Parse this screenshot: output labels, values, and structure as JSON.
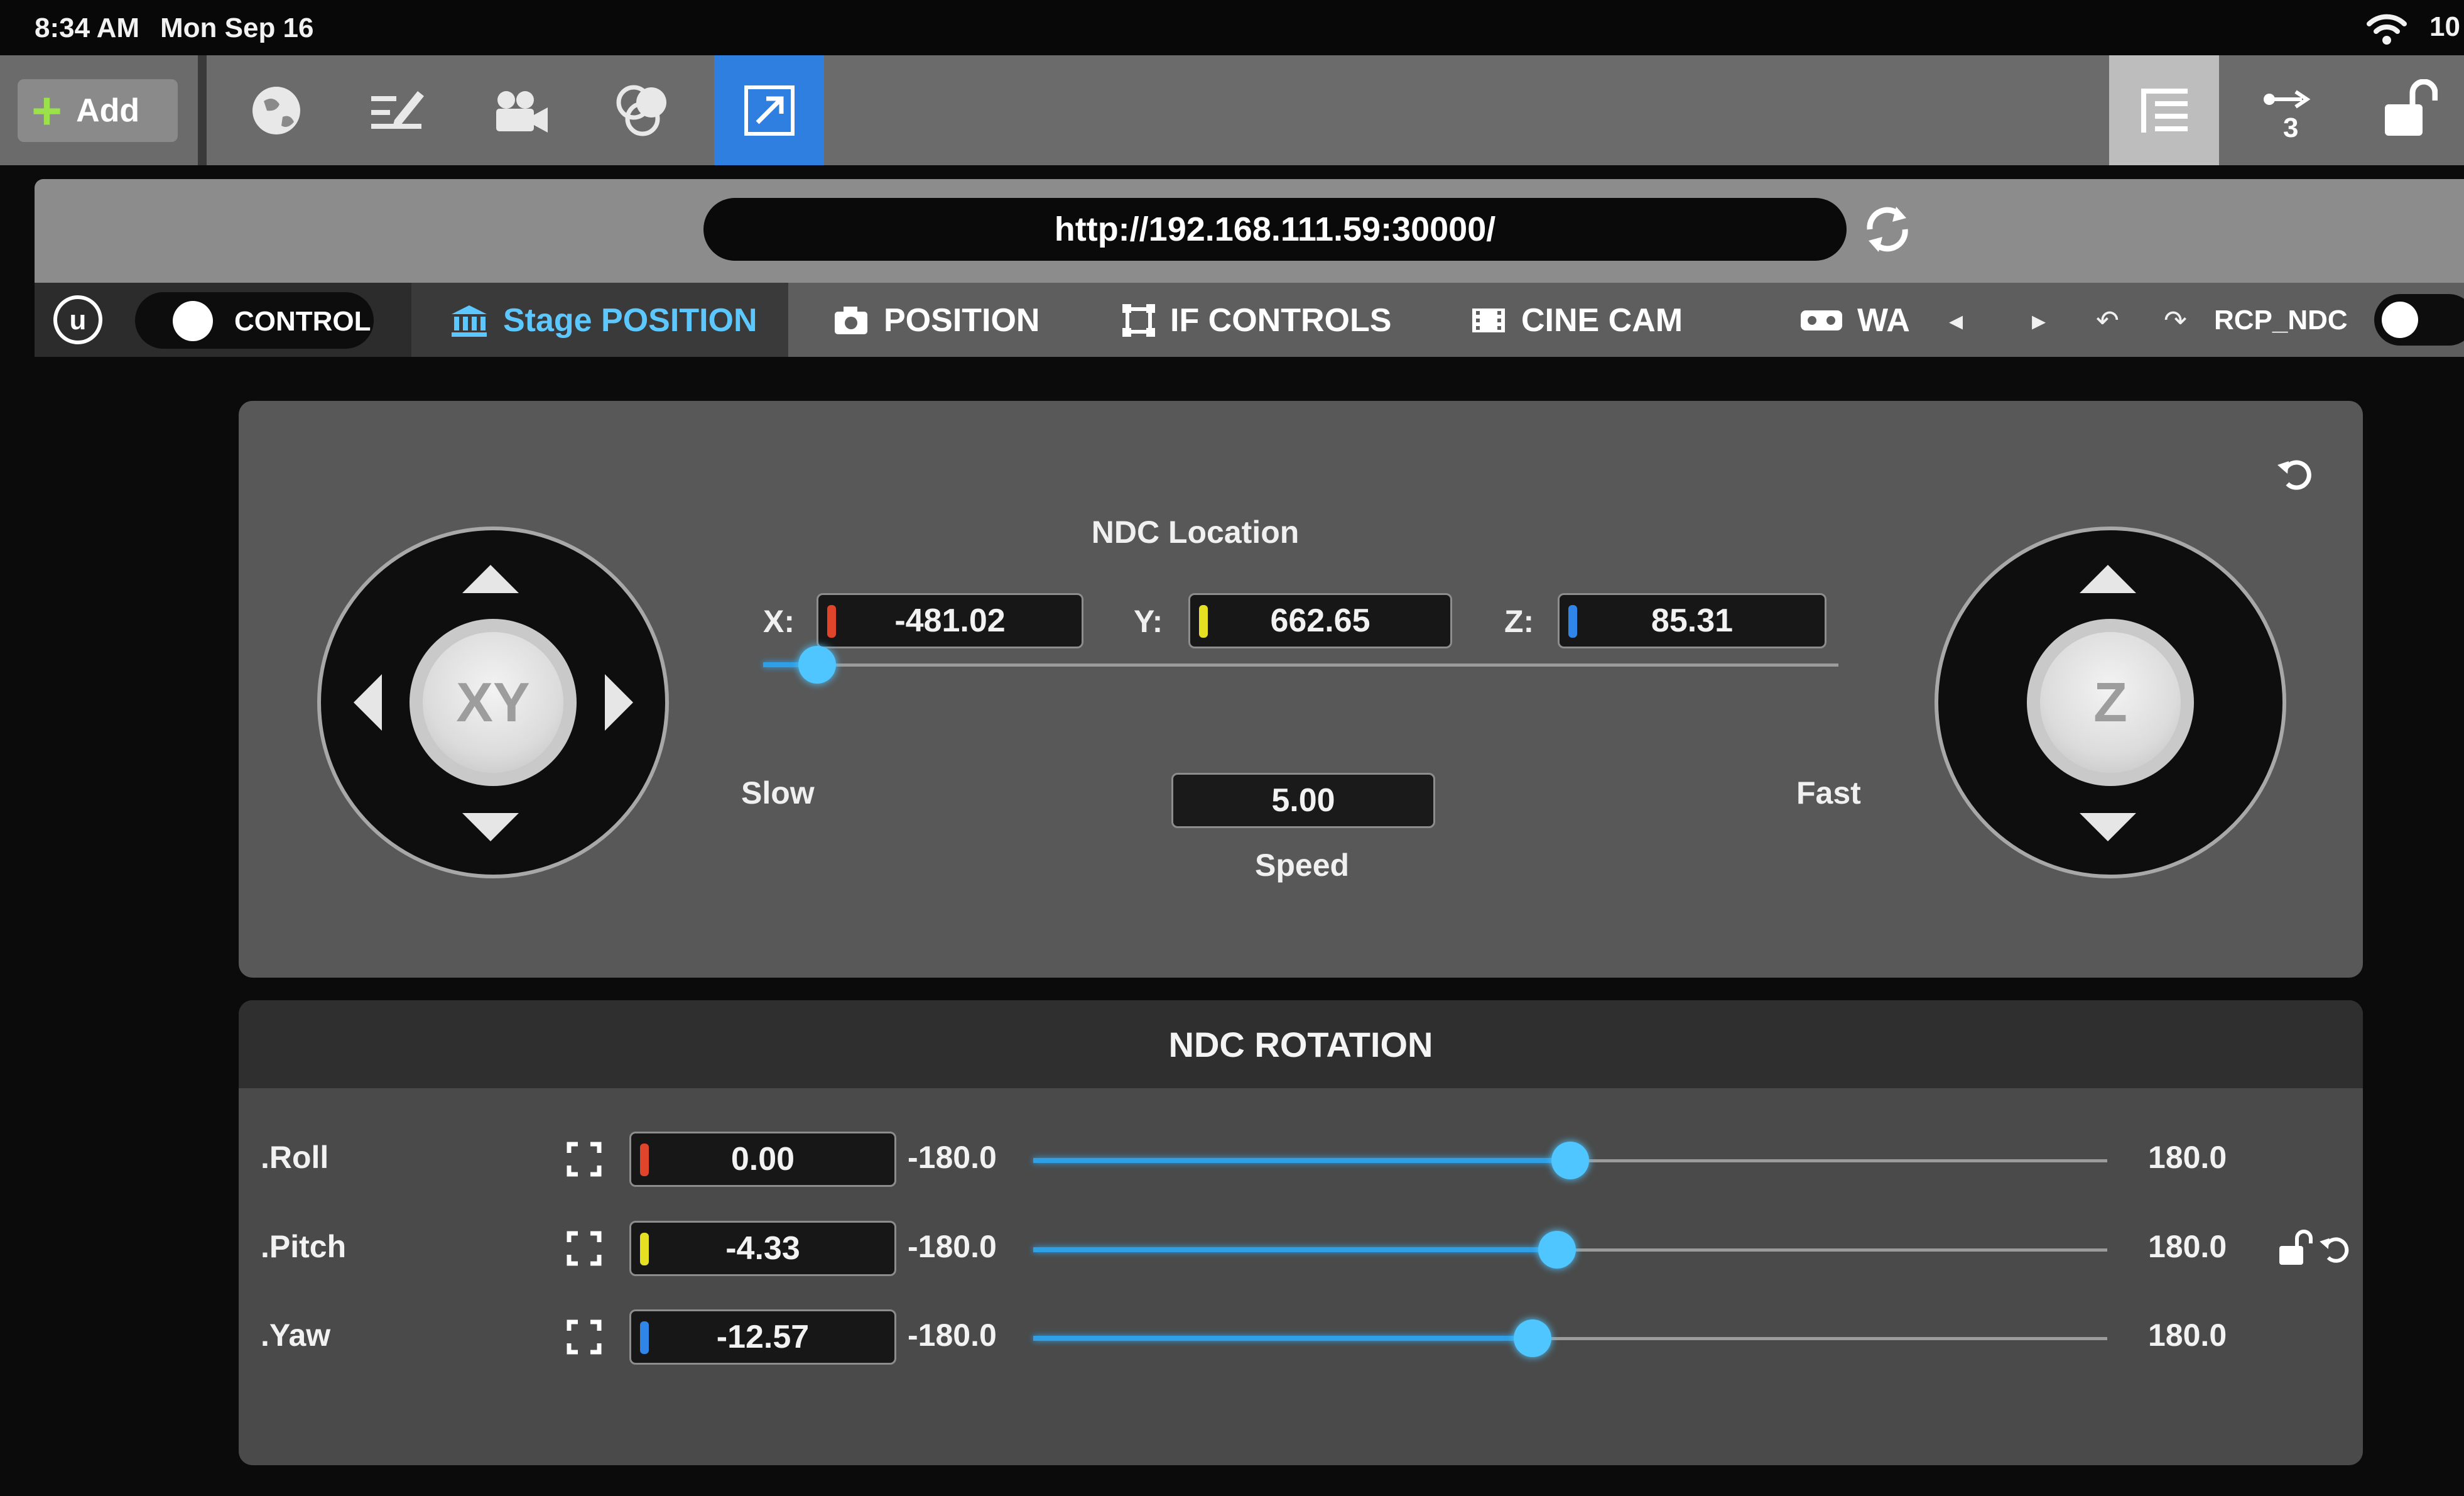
{
  "status_bar": {
    "time": "8:34 AM",
    "date": "Mon Sep 16",
    "battery": "10"
  },
  "toolbar": {
    "add_label": "Add",
    "badge": "3"
  },
  "url_bar": {
    "url": "http://192.168.111.59:30000/"
  },
  "tabs": {
    "control_label": "CONTROL",
    "items": [
      {
        "label": "Stage POSITION",
        "icon": "bank-icon",
        "active": true
      },
      {
        "label": "POSITION",
        "icon": "camera-icon"
      },
      {
        "label": "IF CONTROLS",
        "icon": "frame-icon"
      },
      {
        "label": "CINE CAM",
        "icon": "film-icon"
      },
      {
        "label": "WA",
        "icon": "vr-headset-icon"
      }
    ],
    "preset": "RCP_NDC"
  },
  "location": {
    "title": "NDC Location",
    "joystick_xy": "XY",
    "joystick_z": "Z",
    "x_label": "X:",
    "x": "-481.02",
    "y_label": "Y:",
    "y": "662.65",
    "z_label": "Z:",
    "z": "85.31",
    "slow_label": "Slow",
    "fast_label": "Fast",
    "speed_value": "5.00",
    "speed_label": "Speed",
    "speed_fraction": 0.05
  },
  "rotation": {
    "title": "NDC ROTATION",
    "rows": [
      {
        "label": ".Roll",
        "value": "0.00",
        "min": "-180.0",
        "max": "180.0",
        "num": 0.0
      },
      {
        "label": ".Pitch",
        "value": "-4.33",
        "min": "-180.0",
        "max": "180.0",
        "num": -4.33
      },
      {
        "label": ".Yaw",
        "value": "-12.57",
        "min": "-180.0",
        "max": "180.0",
        "num": -12.57
      }
    ]
  },
  "colors": {
    "accent": "#2f7fe0",
    "slider": "#4fc6ff",
    "x_axis": "#e0442a",
    "y_axis": "#e5e021",
    "z_axis": "#2f86e8"
  }
}
